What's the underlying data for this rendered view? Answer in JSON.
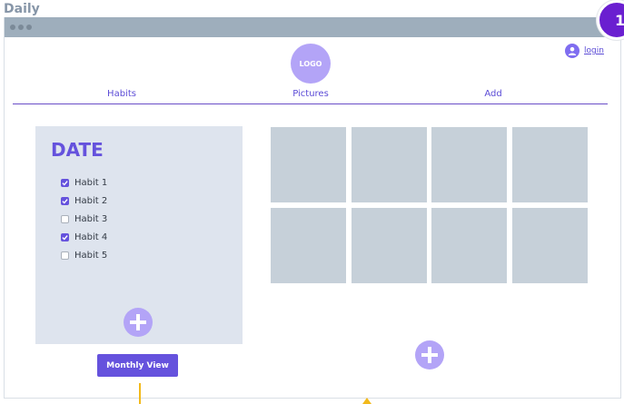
{
  "page": {
    "title": "Daily",
    "step_badge": "1"
  },
  "header": {
    "logo_text": "LOGO",
    "login_label": "login"
  },
  "nav": {
    "items": [
      {
        "label": "Habits"
      },
      {
        "label": "Pictures"
      },
      {
        "label": "Add"
      }
    ]
  },
  "habits": {
    "date_label": "DATE",
    "items": [
      {
        "label": "Habit 1",
        "checked": true
      },
      {
        "label": "Habit 2",
        "checked": true
      },
      {
        "label": "Habit 3",
        "checked": false
      },
      {
        "label": "Habit 4",
        "checked": true
      },
      {
        "label": "Habit 5",
        "checked": false
      }
    ],
    "add_icon": "plus-icon"
  },
  "buttons": {
    "monthly_view": "Monthly View"
  },
  "pictures": {
    "count": 8,
    "add_icon": "plus-icon"
  },
  "colors": {
    "accent": "#6552dd",
    "accent_light": "#b3a4f7",
    "badge": "#6a1fd0",
    "panel": "#dee4ee",
    "thumbnail": "#c6d0d9",
    "annotation": "#f2b91b"
  }
}
